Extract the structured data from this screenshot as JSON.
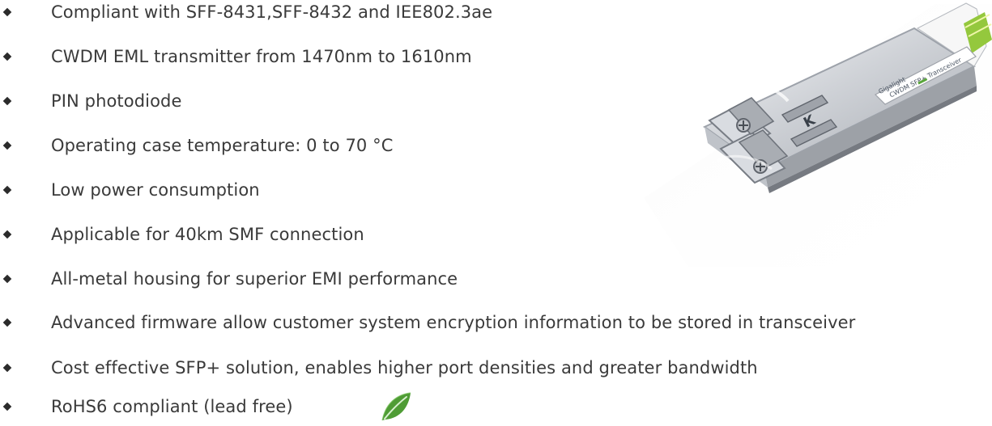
{
  "features": [
    "Compliant with SFF-8431,SFF-8432 and IEE802.3ae",
    "CWDM EML transmitter from 1470nm to 1610nm",
    "PIN photodiode",
    "Operating case temperature: 0 to 70 °C",
    "Low power consumption",
    "Applicable for 40km SMF connection",
    "All-metal housing for superior EMI performance",
    "Advanced firmware allow customer system encryption information to be stored in transceiver",
    "Cost effective SFP+ solution, enables higher port densities and greater bandwidth",
    "RoHS6 compliant (lead free)"
  ],
  "icons": {
    "bullet": "diamond-bullet-icon",
    "rohs": "green-leaf-icon",
    "product": "sfp-transceiver-image"
  },
  "colors": {
    "text": "#3a3a3a",
    "bullet": "#2b2b2b",
    "leaf": "#4f9c35",
    "metal": "#c7c9cd"
  }
}
